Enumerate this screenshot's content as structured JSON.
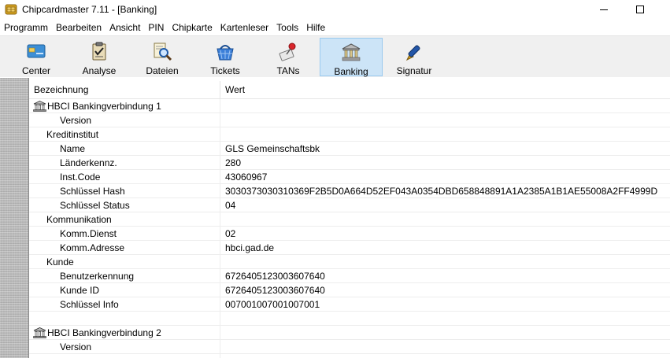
{
  "window": {
    "title": "Chipcardmaster 7.11 - [Banking]"
  },
  "menu": [
    "Programm",
    "Bearbeiten",
    "Ansicht",
    "PIN",
    "Chipkarte",
    "Kartenleser",
    "Tools",
    "Hilfe"
  ],
  "toolbar": {
    "buttons": [
      {
        "label": "Center",
        "icon": "card-icon",
        "active": false
      },
      {
        "label": "Analyse",
        "icon": "clipboard-icon",
        "active": false
      },
      {
        "label": "Dateien",
        "icon": "magnifier-icon",
        "active": false
      },
      {
        "label": "Tickets",
        "icon": "ticket-basket-icon",
        "active": false
      },
      {
        "label": "TANs",
        "icon": "tan-pin-icon",
        "active": false
      },
      {
        "label": "Banking",
        "icon": "bank-icon",
        "active": true
      },
      {
        "label": "Signatur",
        "icon": "fountain-pen-icon",
        "active": false
      }
    ]
  },
  "grid": {
    "columns": {
      "name": "Bezeichnung",
      "value": "Wert"
    },
    "rows": [
      {
        "level": 0,
        "icon": true,
        "name": "HBCI Bankingverbindung 1",
        "value": ""
      },
      {
        "level": 2,
        "name": "Version",
        "value": ""
      },
      {
        "level": 1,
        "name": "Kreditinstitut",
        "value": ""
      },
      {
        "level": 2,
        "name": "Name",
        "value": "GLS Gemeinschaftsbk"
      },
      {
        "level": 2,
        "name": "Länderkennz.",
        "value": "280"
      },
      {
        "level": 2,
        "name": "Inst.Code",
        "value": "43060967"
      },
      {
        "level": 2,
        "name": "Schlüssel Hash",
        "value": "303037303031036 9F2B5D0A664D52EF043A0354DBD658848891A1A2385A1B1AE55008A2FF4999D"
      },
      {
        "level": 2,
        "name": "Schlüssel Status",
        "value": "04"
      },
      {
        "level": 1,
        "name": "Kommunikation",
        "value": ""
      },
      {
        "level": 2,
        "name": "Komm.Dienst",
        "value": "02"
      },
      {
        "level": 2,
        "name": "Komm.Adresse",
        "value": "hbci.gad.de"
      },
      {
        "level": 1,
        "name": "Kunde",
        "value": ""
      },
      {
        "level": 2,
        "name": "Benutzerkennung",
        "value": "6726405123003607640"
      },
      {
        "level": 2,
        "name": "Kunde ID",
        "value": "6726405123003607640"
      },
      {
        "level": 2,
        "name": "Schlüssel Info",
        "value": "007001007001007001"
      },
      {
        "level": 0,
        "name": "",
        "value": ""
      },
      {
        "level": 0,
        "icon": true,
        "name": "HBCI Bankingverbindung 2",
        "value": ""
      },
      {
        "level": 2,
        "name": "Version",
        "value": ""
      },
      {
        "level": 1,
        "name": "",
        "value": ""
      }
    ]
  }
}
